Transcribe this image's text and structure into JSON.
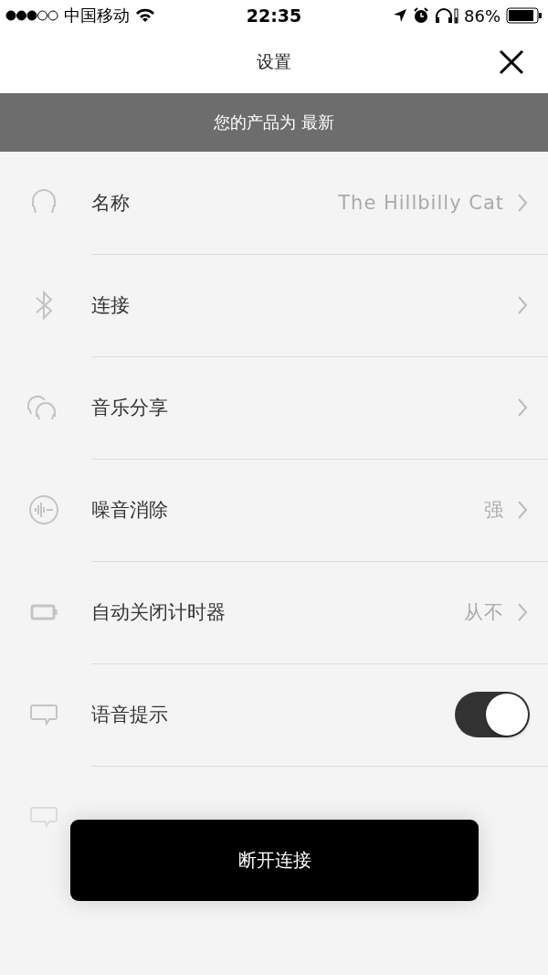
{
  "status_bar": {
    "carrier": "中国移动",
    "time": "22:35",
    "battery": "86%"
  },
  "header": {
    "title": "设置"
  },
  "banner": {
    "text": "您的产品为 最新"
  },
  "settings": [
    {
      "kind": "link",
      "label": "名称",
      "value": "The Hillbilly Cat"
    },
    {
      "kind": "link",
      "label": "连接"
    },
    {
      "kind": "link",
      "label": "音乐分享"
    },
    {
      "kind": "link",
      "label": "噪音消除",
      "value": "强"
    },
    {
      "kind": "link",
      "label": "自动关闭计时器",
      "value": "从不"
    },
    {
      "kind": "toggle",
      "label": "语音提示",
      "on": true
    }
  ],
  "disconnect_button": "断开连接"
}
